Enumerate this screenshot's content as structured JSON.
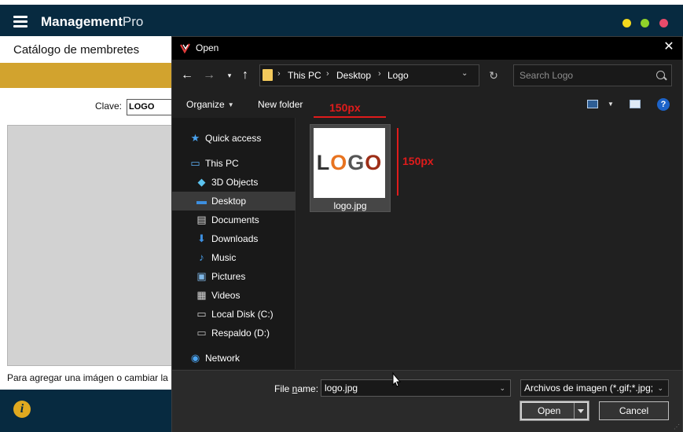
{
  "app": {
    "brand_bold": "Management",
    "brand_light": "Pro",
    "page_title": "Catálogo de membretes",
    "clave_label": "Clave:",
    "clave_value": "LOGO",
    "hint_text": "Para agregar una imágen o cambiar la",
    "window_dots": [
      "#f3d81d",
      "#8fd32a",
      "#e94b6b"
    ]
  },
  "dialog": {
    "title": "Open",
    "breadcrumb": [
      "This PC",
      "Desktop",
      "Logo"
    ],
    "search_placeholder": "Search Logo",
    "toolbar": {
      "organize": "Organize",
      "new_folder": "New folder",
      "help": "?"
    },
    "nav_items": [
      {
        "label": "Quick access",
        "icon": "star-icon"
      },
      {
        "label": "This PC",
        "icon": "pc-icon"
      },
      {
        "label": "3D Objects",
        "icon": "cube-icon"
      },
      {
        "label": "Desktop",
        "icon": "desktop-icon",
        "selected": true
      },
      {
        "label": "Documents",
        "icon": "document-icon"
      },
      {
        "label": "Downloads",
        "icon": "download-icon"
      },
      {
        "label": "Music",
        "icon": "music-icon"
      },
      {
        "label": "Pictures",
        "icon": "pictures-icon"
      },
      {
        "label": "Videos",
        "icon": "video-icon"
      },
      {
        "label": "Local Disk (C:)",
        "icon": "disk-icon"
      },
      {
        "label": "Respaldo (D:)",
        "icon": "drive-icon"
      },
      {
        "label": "Network",
        "icon": "network-icon"
      }
    ],
    "file": {
      "name": "logo.jpg",
      "thumb_letters": [
        "L",
        "O",
        "G",
        "O"
      ],
      "thumb_colors": [
        "#333333",
        "#e8731f",
        "#555555",
        "#9e2f18"
      ]
    },
    "annotations": {
      "width_label": "150px",
      "height_label": "150px",
      "color": "#e01b1b"
    },
    "file_name_label_pre": "File ",
    "file_name_label_u": "n",
    "file_name_label_post": "ame:",
    "file_name_value": "logo.jpg",
    "filter_value": "Archivos de imagen (*.gif;*.jpg;",
    "open_label": "Open",
    "cancel_label": "Cancel"
  }
}
